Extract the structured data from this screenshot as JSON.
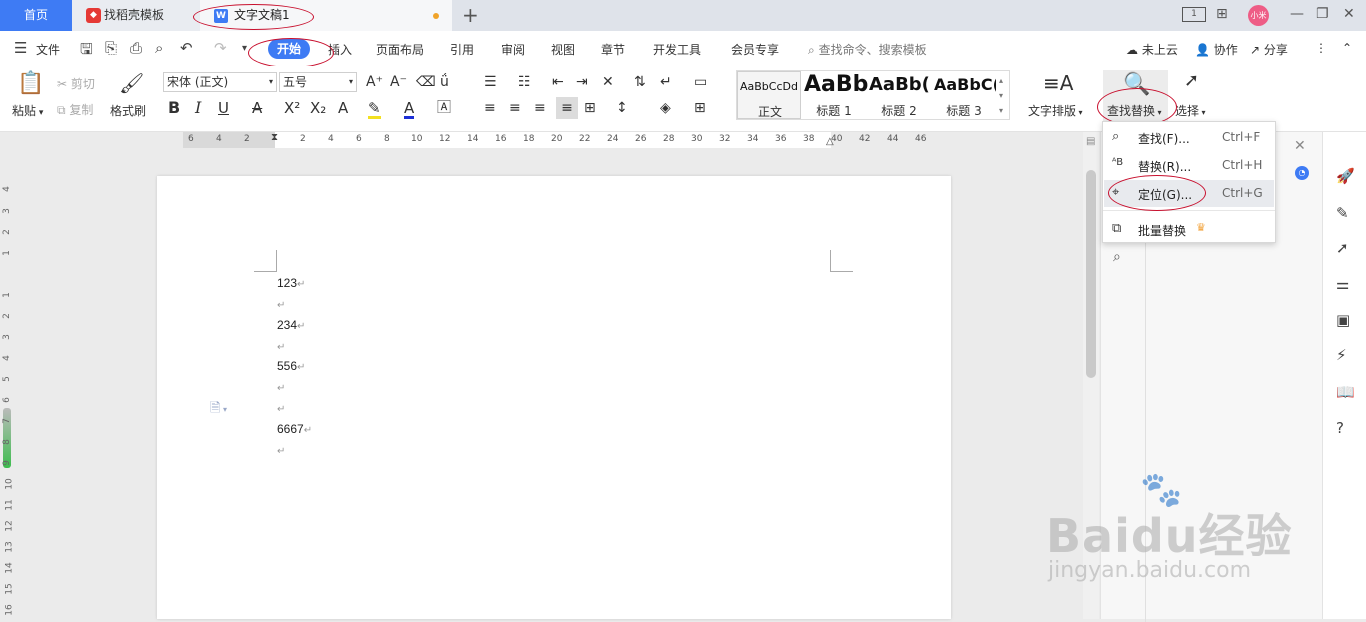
{
  "tabs": {
    "home": "首页",
    "templates": "找稻壳模板",
    "document": "文字文稿1"
  },
  "window": {
    "page_count_icon": "1",
    "avatar_text": "小米"
  },
  "menu": {
    "file": "文件",
    "items": [
      "开始",
      "插入",
      "页面布局",
      "引用",
      "审阅",
      "视图",
      "章节",
      "开发工具",
      "会员专享"
    ],
    "search_placeholder": "查找命令、搜索模板",
    "cloud": "未上云",
    "collab": "协作",
    "share": "分享"
  },
  "ribbon": {
    "paste": "粘贴",
    "cut": "剪切",
    "copy": "复制",
    "format_painter": "格式刷",
    "font_name": "宋体 (正文)",
    "font_size": "五号",
    "styles": [
      {
        "preview": "AaBbCcDd",
        "name": "正文"
      },
      {
        "preview": "AaBb",
        "name": "标题 1"
      },
      {
        "preview": "AaBb(",
        "name": "标题 2"
      },
      {
        "preview": "AaBbC(",
        "name": "标题 3"
      }
    ],
    "text_layout": "文字排版",
    "find_replace": "查找替换",
    "select": "选择"
  },
  "ruler": {
    "h_ticks": [
      "6",
      "4",
      "2",
      "2",
      "4",
      "6",
      "8",
      "10",
      "12",
      "14",
      "16",
      "18",
      "20",
      "22",
      "24",
      "26",
      "28",
      "30",
      "32",
      "34",
      "36",
      "38",
      "40",
      "42",
      "44",
      "46"
    ],
    "v_ticks": [
      "4",
      "3",
      "2",
      "1",
      "1",
      "2",
      "3",
      "4",
      "5",
      "6",
      "7",
      "8",
      "9",
      "10",
      "11",
      "12",
      "13",
      "14",
      "15",
      "16"
    ]
  },
  "document": {
    "lines": [
      "123",
      "",
      "234",
      "",
      "556",
      "",
      "",
      "6667",
      ""
    ],
    "paragraph_mark": "↵"
  },
  "find_menu": {
    "items": [
      {
        "label": "查找(F)...",
        "shortcut": "Ctrl+F",
        "icon": "search-icon"
      },
      {
        "label": "替换(R)...",
        "shortcut": "Ctrl+H",
        "icon": "replace-icon"
      },
      {
        "label": "定位(G)...",
        "shortcut": "Ctrl+G",
        "icon": "goto-icon"
      },
      {
        "label": "批量替换",
        "shortcut": "",
        "icon": "batch-replace-icon"
      }
    ]
  },
  "watermark": {
    "brand": "Baidu经验",
    "url": "jingyan.baidu.com"
  },
  "colors": {
    "accent": "#3e7bf4",
    "annotation": "#c8102e"
  }
}
